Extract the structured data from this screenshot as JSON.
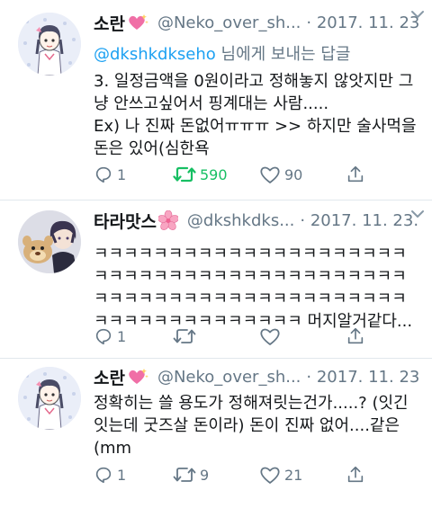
{
  "colors": {
    "accent_blue": "#1da1f2",
    "retweet_green": "#17bf63",
    "secondary_text": "#657786",
    "primary_text": "#14171a",
    "heart_pink": "#e0245e",
    "blossom_pink": "#f48fb1"
  },
  "tweets": [
    {
      "display_name": "소란",
      "name_emoji": "sparkling-heart-emoji",
      "handle": "@Neko_over_sh...",
      "date": "· 2017. 11. 23.",
      "reply_to": {
        "mention": "@dkshkdkseho",
        "suffix": " 님에게 보내는 답글"
      },
      "body_lines": [
        "3. 일정금액을 0원이라고 정해놓지 않앗지만 그",
        "냥 안쓰고싶어서 핑계대는 사람.....",
        "Ex) 나 진짜 돈없어ㅠㅠㅠ  >> 하지만 술사먹을",
        "돈은 있어(심한욕"
      ],
      "actions": {
        "reply_count": "1",
        "retweet_count": "590",
        "like_count": "90",
        "retweeted": true
      }
    },
    {
      "display_name": "타라맛스",
      "name_emoji": "cherry-blossom-emoji",
      "handle": "@dkshkdks...",
      "date": "· 2017. 11. 23.",
      "body_lines": [
        "ㅋㅋㅋㅋㅋㅋㅋㅋㅋㅋㅋㅋㅋㅋㅋㅋㅋㅋㅋㅋㅋ",
        "ㅋㅋㅋㅋㅋㅋㅋㅋㅋㅋㅋㅋㅋㅋㅋㅋㅋㅋㅋㅋㅋ",
        "ㅋㅋㅋㅋㅋㅋㅋㅋㅋㅋㅋㅋㅋㅋㅋㅋㅋㅋㅋㅋㅋ",
        "ㅋㅋㅋㅋㅋㅋㅋㅋㅋㅋㅋㅋㅋㅋ 머지알거같다..."
      ],
      "actions": {
        "reply_count": "1",
        "retweet_count": "",
        "like_count": "",
        "retweeted": false
      }
    },
    {
      "display_name": "소란",
      "name_emoji": "sparkling-heart-emoji",
      "handle": "@Neko_over_sh...",
      "date": "· 2017. 11. 23.",
      "body_lines": [
        "정확히는 쓸 용도가 정해져릿는건가.....? (잇긴",
        "잇는데 굿즈살 돈이라) 돈이 진짜 없어....같은",
        "(mm"
      ],
      "actions": {
        "reply_count": "1",
        "retweet_count": "9",
        "like_count": "21",
        "retweeted": false
      }
    }
  ]
}
